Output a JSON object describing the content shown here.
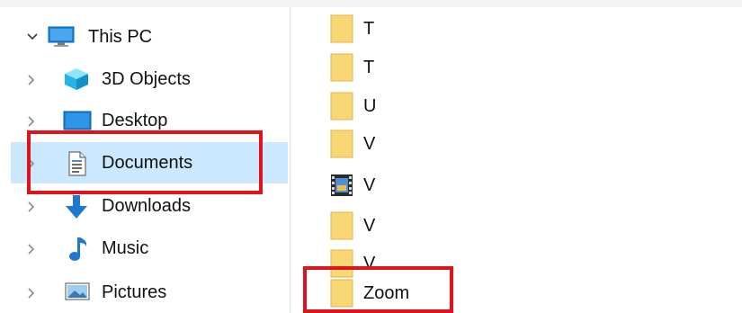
{
  "nav": {
    "items": [
      {
        "label": "This PC",
        "icon": "monitor-icon",
        "expanded": true,
        "selected": false
      },
      {
        "label": "3D Objects",
        "icon": "cube-icon",
        "expanded": false,
        "selected": false
      },
      {
        "label": "Desktop",
        "icon": "desktop-icon",
        "expanded": false,
        "selected": false
      },
      {
        "label": "Documents",
        "icon": "document-icon",
        "expanded": false,
        "selected": true
      },
      {
        "label": "Downloads",
        "icon": "download-arrow-icon",
        "expanded": false,
        "selected": false
      },
      {
        "label": "Music",
        "icon": "music-note-icon",
        "expanded": false,
        "selected": false
      },
      {
        "label": "Pictures",
        "icon": "picture-icon",
        "expanded": false,
        "selected": false
      }
    ]
  },
  "files": {
    "items": [
      {
        "label": "T",
        "icon": "folder-icon"
      },
      {
        "label": "T",
        "icon": "folder-icon"
      },
      {
        "label": "U",
        "icon": "folder-icon"
      },
      {
        "label": "V",
        "icon": "folder-icon"
      },
      {
        "label": "V",
        "icon": "video-file-icon"
      },
      {
        "label": "V",
        "icon": "folder-icon"
      },
      {
        "label": "V..",
        "icon": "folder-icon"
      },
      {
        "label": "Zoom",
        "icon": "folder-icon"
      }
    ]
  },
  "colors": {
    "selection": "#cce8ff",
    "highlight_box": "#e0121c",
    "folder": "#f8d775"
  }
}
